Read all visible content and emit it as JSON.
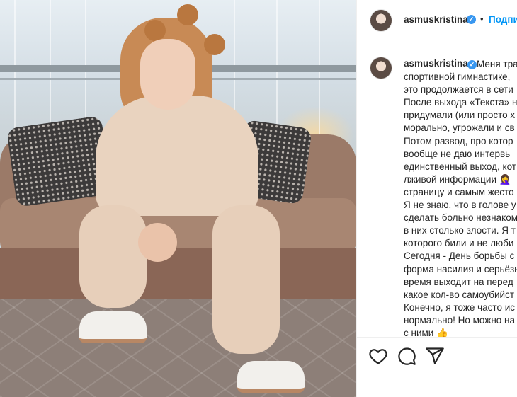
{
  "post": {
    "username": "asmuskristina",
    "header_action": "Подпи",
    "dot": "•"
  },
  "caption": {
    "username": "asmuskristina",
    "lines": [
      "Меня тра",
      "спортивной гимнастике,",
      "это продолжается в сети",
      "После выхода «Текста» н",
      "придумали (или просто х",
      "морально, угрожали и св",
      "Потом развод, про котор",
      "вообще не даю интервь",
      "единственный выход, кот",
      "лживой информации 🤦‍♀️",
      "страницу и самым жесто",
      "Я не знаю, что в голове у",
      "сделать больно незнаком",
      "в них столько злости. Я т",
      "которого били и не люби",
      "Сегодня - День борьбы с",
      "форма насилия и серьёзн",
      "время выходит на перед",
      "какое кол-во самоубийст",
      "Конечно, я тоже часто ис",
      "нормально! Но можно на",
      "с ними 👍"
    ]
  },
  "icons": {
    "like": "heart-icon",
    "comment": "comment-icon",
    "share": "share-icon",
    "verified": "verified-badge-icon"
  },
  "colors": {
    "link": "#0095f6",
    "verified": "#3897f0",
    "text": "#262626"
  }
}
